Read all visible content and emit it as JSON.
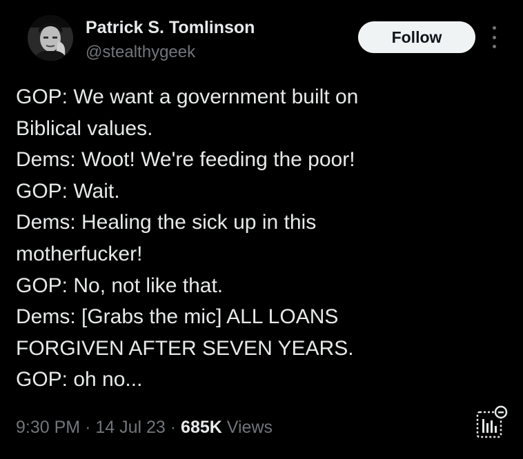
{
  "author": {
    "name": "Patrick S. Tomlinson",
    "handle": "@stealthygeek",
    "avatar_icon": "profile-photo-avatar"
  },
  "actions": {
    "follow_label": "Follow",
    "more_icon": "more-vertical-icon"
  },
  "tweet": {
    "lines": [
      "GOP: We want a government built on",
      "Biblical values.",
      "Dems: Woot! We're feeding the poor!",
      "GOP: Wait.",
      "Dems: Healing the sick up in this",
      "motherfucker!",
      "GOP: No, not like that.",
      "Dems: [Grabs the mic] ALL LOANS",
      "FORGIVEN AFTER SEVEN YEARS.",
      "GOP: oh no..."
    ]
  },
  "meta": {
    "time": "9:30 PM",
    "separator": "·",
    "date": "14 Jul 23",
    "views_count": "685K",
    "views_label": "Views",
    "analytics_icon": "post-analytics-icon"
  },
  "colors": {
    "background": "#000000",
    "primary_text": "#e7e9ea",
    "secondary_text": "#71767b",
    "follow_bg": "#eff3f4",
    "follow_text": "#0f1419"
  }
}
